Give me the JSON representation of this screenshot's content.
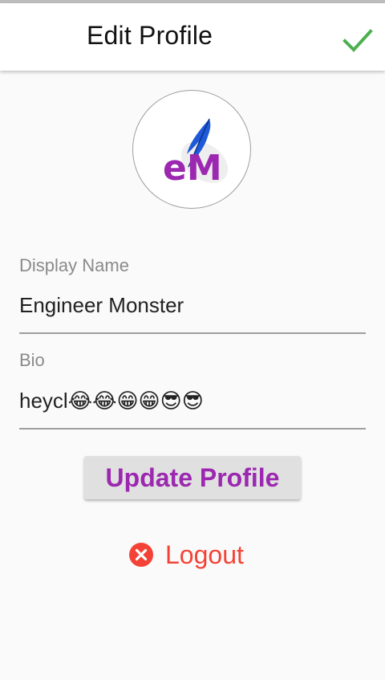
{
  "appbar": {
    "title": "Edit Profile",
    "save_icon": "check-icon"
  },
  "avatar": {
    "logo_text": "eM"
  },
  "display_name": {
    "label": "Display Name",
    "value": "Engineer Monster"
  },
  "bio": {
    "label": "Bio",
    "value": "heycl😂😂😁😁😎😎"
  },
  "actions": {
    "update_label": "Update Profile",
    "logout_label": "Logout",
    "logout_icon": "cancel-icon"
  },
  "colors": {
    "check": "#4caf50",
    "update_text": "#9c27b0",
    "logout": "#f44336",
    "feather": "#1e5ad8"
  }
}
